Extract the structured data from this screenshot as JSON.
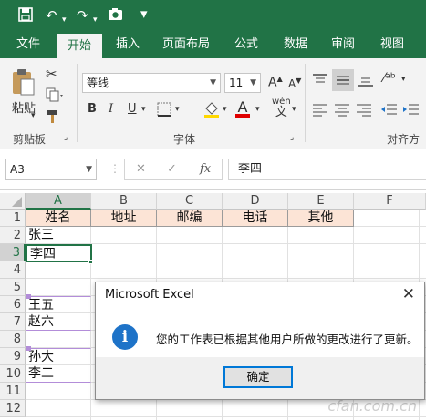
{
  "quick_access": {
    "save_icon": "save-icon",
    "undo_icon": "undo-icon",
    "redo_icon": "redo-icon",
    "camera_icon": "camera-icon"
  },
  "tabs": [
    {
      "label": "文件"
    },
    {
      "label": "开始"
    },
    {
      "label": "插入"
    },
    {
      "label": "页面布局"
    },
    {
      "label": "公式"
    },
    {
      "label": "数据"
    },
    {
      "label": "审阅"
    },
    {
      "label": "视图"
    }
  ],
  "ribbon": {
    "paste_label": "粘贴",
    "clipboard_group": "剪贴板",
    "font_name": "等线",
    "font_size": "11",
    "bold": "B",
    "italic": "I",
    "underline": "U",
    "font_group": "字体",
    "phonetic_label": "wén",
    "align_group": "对齐方式",
    "grow_font": "A",
    "shrink_font": "A",
    "font_color_letter": "A",
    "accent_fill": "#ffd800",
    "accent_font_color": "#e00000"
  },
  "formula_bar": {
    "cell_ref": "A3",
    "cancel": "✕",
    "enter": "✓",
    "fx": "fx",
    "value": "李四"
  },
  "grid": {
    "columns": [
      "A",
      "B",
      "C",
      "D",
      "E",
      "F"
    ],
    "rows": [
      "1",
      "2",
      "3",
      "4",
      "5",
      "6",
      "7",
      "8",
      "9",
      "10",
      "11",
      "12"
    ],
    "header_row": [
      "姓名",
      "地址",
      "邮编",
      "电话",
      "其他"
    ],
    "cells": {
      "a2": "张三",
      "a3": "李四",
      "a6": "王五",
      "a7": "赵六",
      "a9": "孙大",
      "a10": "李二"
    }
  },
  "dialog": {
    "title": "Microsoft Excel",
    "close": "✕",
    "icon": "info-icon",
    "icon_glyph": "i",
    "message": "您的工作表已根据其他用户所做的更改进行了更新。",
    "ok_label": "确定"
  },
  "colors": {
    "brand": "#217346",
    "header_fill": "#fce4d6",
    "selection": "#217346",
    "dialog_button_border": "#0078d7"
  },
  "watermark": "cfan.com.cn"
}
